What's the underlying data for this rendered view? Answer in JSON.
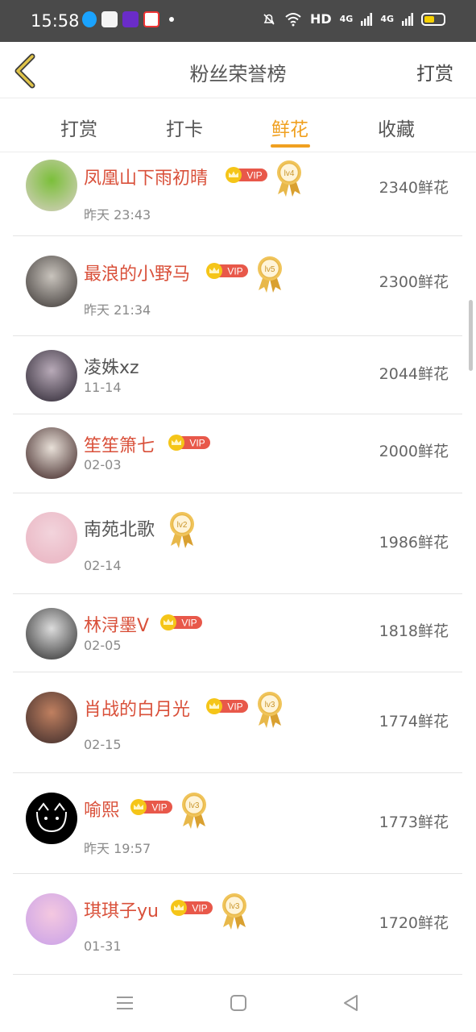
{
  "status_bar": {
    "time": "15:58",
    "network_label": "HD",
    "signal_1": "4G",
    "signal_2": "4G"
  },
  "header": {
    "title": "粉丝荣誉榜",
    "right_action": "打赏"
  },
  "tabs": [
    {
      "label": "打赏",
      "active": false
    },
    {
      "label": "打卡",
      "active": false
    },
    {
      "label": "鲜花",
      "active": true
    },
    {
      "label": "收藏",
      "active": false
    }
  ],
  "ranking": [
    {
      "name": "凤凰山下雨初晴",
      "time": "昨天 23:43",
      "amount": "2340鲜花",
      "vip": true,
      "level": "lv4",
      "name_color": "red"
    },
    {
      "name": "最浪的小野马",
      "time": "昨天 21:34",
      "amount": "2300鲜花",
      "vip": true,
      "level": "lv5",
      "name_color": "red"
    },
    {
      "name": "凌姝xz",
      "time": "11-14",
      "amount": "2044鲜花",
      "vip": false,
      "level": "",
      "name_color": "gray"
    },
    {
      "name": "笙笙箫七",
      "time": "02-03",
      "amount": "2000鲜花",
      "vip": true,
      "level": "",
      "name_color": "red"
    },
    {
      "name": "南苑北歌",
      "time": "02-14",
      "amount": "1986鲜花",
      "vip": false,
      "level": "lv2",
      "name_color": "gray"
    },
    {
      "name": "林浔墨V",
      "time": "02-05",
      "amount": "1818鲜花",
      "vip": true,
      "level": "",
      "name_color": "red"
    },
    {
      "name": "肖战的白月光",
      "time": "02-15",
      "amount": "1774鲜花",
      "vip": true,
      "level": "lv3",
      "name_color": "red"
    },
    {
      "name": "喻熙",
      "time": "昨天 19:57",
      "amount": "1773鲜花",
      "vip": true,
      "level": "lv3",
      "name_color": "red"
    },
    {
      "name": "琪琪子yu",
      "time": "01-31",
      "amount": "1720鲜花",
      "vip": true,
      "level": "lv3",
      "name_color": "red"
    }
  ],
  "vip_label": "VIP",
  "colors": {
    "accent": "#f0a020",
    "vip_name": "#d9503a",
    "vip_badge": "#e8584a",
    "crown": "#f5c518"
  },
  "icons": {
    "back": "chevron-left-icon",
    "menu": "menu-icon",
    "home": "home-icon",
    "back_nav": "back-triangle-icon"
  }
}
